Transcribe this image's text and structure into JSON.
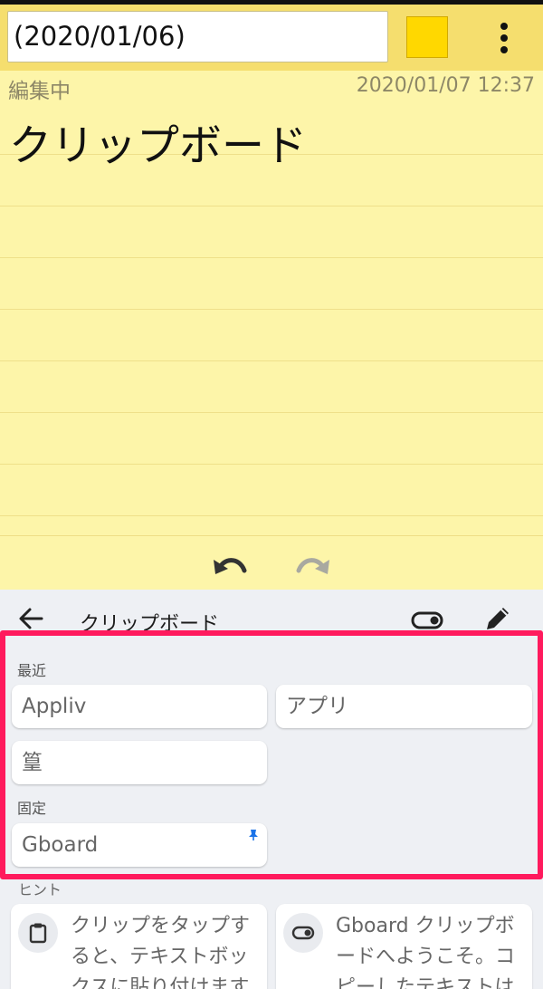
{
  "note": {
    "title": "(2020/01/06)",
    "status": "編集中",
    "timestamp": "2020/01/07 12:37",
    "body": "クリップボード",
    "color": "#ffd800"
  },
  "clipboard": {
    "title": "クリップボード",
    "recent_label": "最近",
    "recent_items": [
      "Appliv",
      "アプリ",
      "篁"
    ],
    "pinned_label": "固定",
    "pinned_items": [
      "Gboard"
    ],
    "hint_label": "ヒント",
    "hints": [
      {
        "icon": "clipboard-icon",
        "text": "クリップをタップすると、テキストボックスに貼り付けます"
      },
      {
        "icon": "toggle-icon",
        "text": "Gboard クリップボードへようこそ。コピーしたテキストは"
      }
    ],
    "highlight_color": "#ff1a5d"
  },
  "icons": {
    "more": "more-vert-icon",
    "undo": "undo-icon",
    "redo": "redo-icon",
    "back": "arrow-back-icon",
    "toggle": "toggle-icon",
    "edit": "pencil-icon",
    "pin": "pin-icon"
  }
}
